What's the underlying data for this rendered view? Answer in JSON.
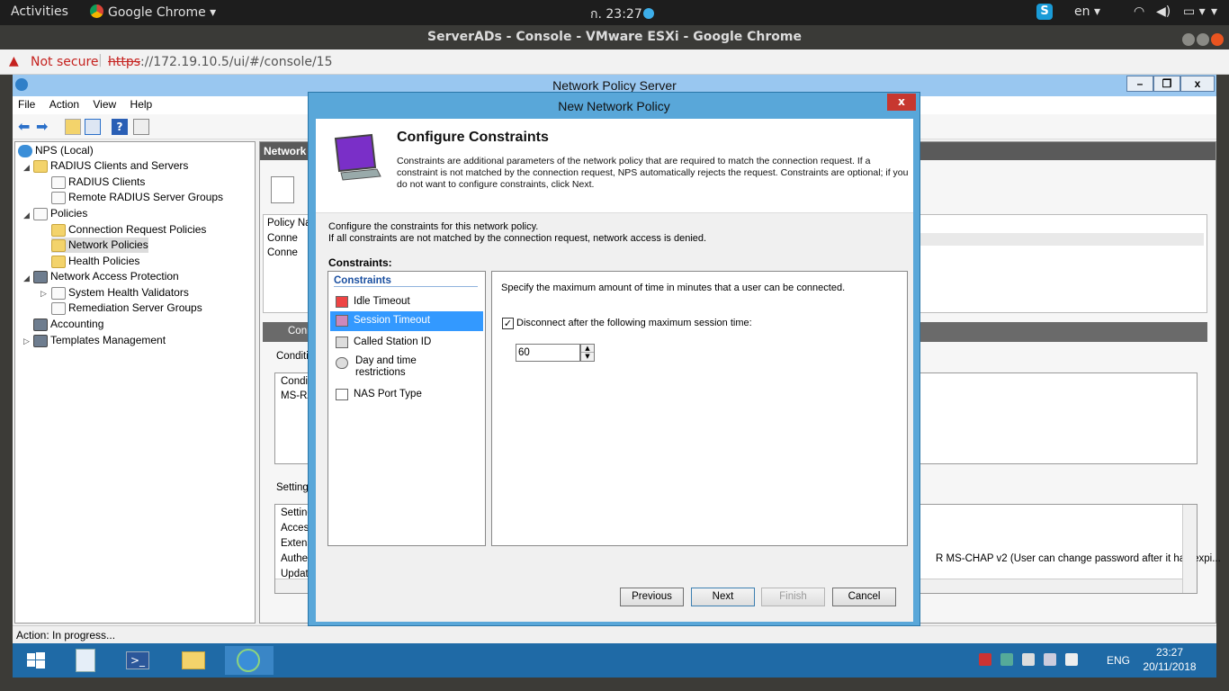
{
  "os_topbar": {
    "activities": "Activities",
    "app_name": "Google Chrome",
    "clock": "ก. 23:27",
    "lang": "en"
  },
  "chrome": {
    "window_title": "ServerADs - Console - VMware ESXi - Google Chrome",
    "not_secure": "Not secure",
    "url_scheme": "https",
    "url_rest": "://172.19.10.5/ui/#/console/15"
  },
  "nps": {
    "title": "Network Policy Server",
    "menu": [
      "File",
      "Action",
      "View",
      "Help"
    ],
    "tree": {
      "root": "NPS (Local)",
      "radius_clients_servers": "RADIUS Clients and Servers",
      "radius_clients": "RADIUS Clients",
      "remote_radius_groups": "Remote RADIUS Server Groups",
      "policies": "Policies",
      "connection_request_policies": "Connection Request Policies",
      "network_policies": "Network Policies",
      "health_policies": "Health Policies",
      "nap": "Network Access Protection",
      "system_health_validators": "System Health Validators",
      "remediation_groups": "Remediation Server Groups",
      "accounting": "Accounting",
      "templates": "Templates Management"
    },
    "right_pane": {
      "header": "Network",
      "policy_col": "Policy Nar",
      "row1": "Conne",
      "row2": "Conne",
      "section2": "Conn",
      "conditions_label": "Conditic",
      "cond_col": "Conditi",
      "cond_val": "MS-RA",
      "settings_label": "Settings",
      "settings_rows": [
        "Setting",
        "Acces",
        "Extens",
        "Auther",
        "Update"
      ],
      "auth_text": "R MS-CHAP v2 (User can change password after it has expi..."
    },
    "status": "Action:  In progress..."
  },
  "taskbar": {
    "lang": "ENG",
    "time": "23:27",
    "date": "20/11/2018"
  },
  "dialog": {
    "title": "New Network Policy",
    "close": "x",
    "header_title": "Configure Constraints",
    "header_desc": "Constraints are additional parameters of the network policy that are required to match the connection request. If a constraint is not matched by the connection request, NPS automatically rejects the request. Constraints are optional; if you do not want to configure constraints, click Next.",
    "intro_line1": "Configure the constraints for this network policy.",
    "intro_line2": "If all constraints are not matched by the connection request, network access is denied.",
    "constraints_label": "Constraints:",
    "list_header": "Constraints",
    "items": [
      "Idle Timeout",
      "Session Timeout",
      "Called Station ID",
      "Day and time restrictions",
      "NAS Port Type"
    ],
    "selected_index": 1,
    "panel_desc": "Specify the maximum amount of time in minutes that a user can be connected.",
    "checkbox_label": "Disconnect after the following maximum session time:",
    "checkbox_checked": true,
    "session_value": "60",
    "buttons": {
      "previous": "Previous",
      "next": "Next",
      "finish": "Finish",
      "cancel": "Cancel"
    }
  }
}
